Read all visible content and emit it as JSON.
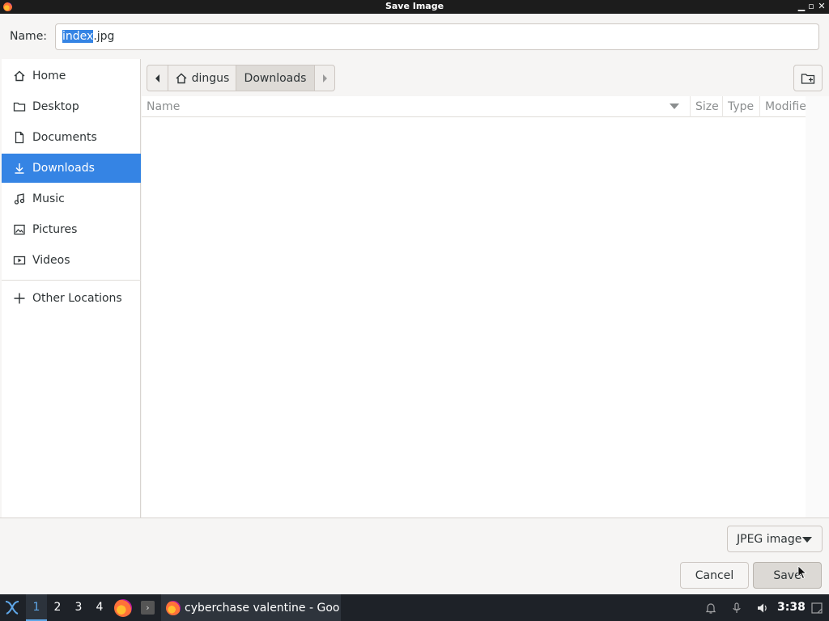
{
  "window": {
    "title": "Save Image"
  },
  "name_field": {
    "label": "Name:",
    "value_selected": "index",
    "value_rest": ".jpg"
  },
  "sidebar": {
    "items": [
      {
        "label": "Home",
        "icon": "home-icon"
      },
      {
        "label": "Desktop",
        "icon": "folder-icon"
      },
      {
        "label": "Documents",
        "icon": "document-icon"
      },
      {
        "label": "Downloads",
        "icon": "download-icon",
        "active": true
      },
      {
        "label": "Music",
        "icon": "music-icon"
      },
      {
        "label": "Pictures",
        "icon": "picture-icon"
      },
      {
        "label": "Videos",
        "icon": "video-icon"
      }
    ],
    "other": {
      "label": "Other Locations",
      "icon": "plus-icon"
    }
  },
  "pathbar": {
    "home_label": "dingus",
    "current_label": "Downloads"
  },
  "file_list": {
    "columns": [
      "Name",
      "Size",
      "Type",
      "Modifie"
    ],
    "rows": []
  },
  "filter": {
    "label": "JPEG image"
  },
  "buttons": {
    "cancel": "Cancel",
    "save": "Save"
  },
  "taskbar": {
    "workspaces": [
      "1",
      "2",
      "3",
      "4"
    ],
    "active_workspace": "1",
    "task_label": "cyberchase valentine - Goo...",
    "clock": "3:38"
  },
  "colors": {
    "accent": "#3584e4",
    "taskbar": "#1e2228",
    "titlebar": "#1c1c1c"
  }
}
